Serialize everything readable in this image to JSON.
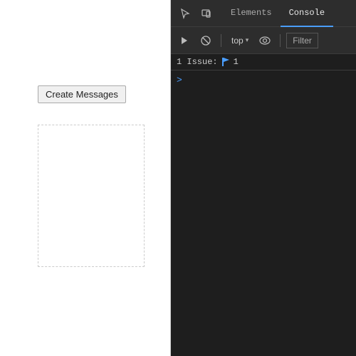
{
  "browser_page": {
    "create_messages_button_label": "Create Messages"
  },
  "devtools": {
    "header": {
      "cursor_icon": "⬆",
      "box_icon": "⬜",
      "tabs": [
        {
          "label": "Elements",
          "active": false
        },
        {
          "label": "Console",
          "active": true
        }
      ]
    },
    "toolbar": {
      "play_icon": "▶",
      "stop_icon": "⊘",
      "top_label": "top",
      "dropdown_arrow": "▾",
      "eye_icon": "◉",
      "filter_label": "Filter"
    },
    "issues_bar": {
      "label": "1 Issue:",
      "count": "1"
    },
    "console": {
      "prompt_arrow": ">"
    }
  }
}
